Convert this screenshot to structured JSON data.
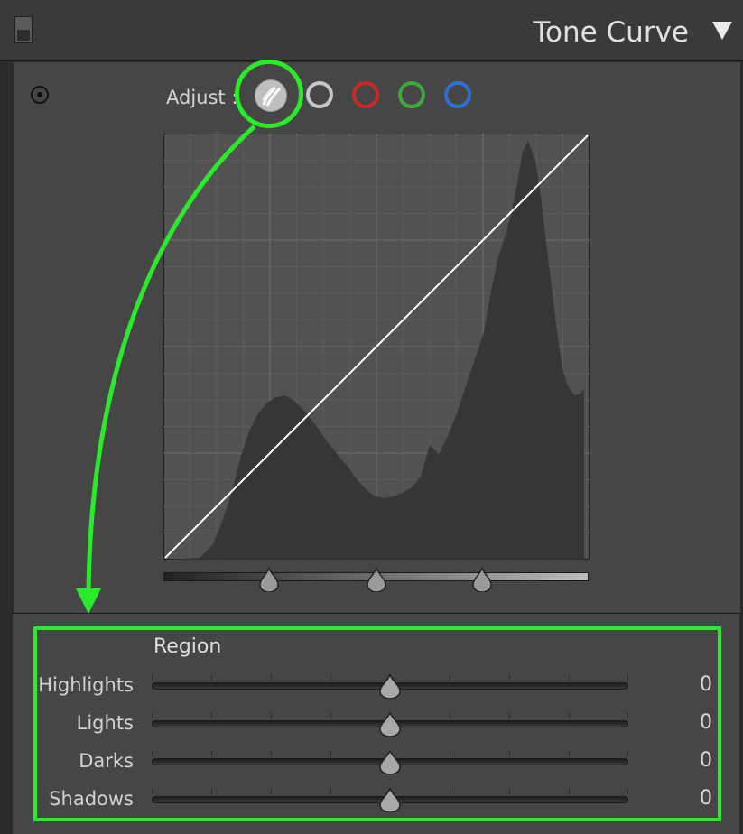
{
  "panel": {
    "title": "Tone Curve"
  },
  "adjust": {
    "label": "Adjust :",
    "channels": [
      {
        "name": "parametric",
        "color": "#bfbfbf",
        "selected": true
      },
      {
        "name": "rgb",
        "color": "#c6c6c6"
      },
      {
        "name": "red",
        "color": "#c62a2a"
      },
      {
        "name": "green",
        "color": "#3ea83e"
      },
      {
        "name": "blue",
        "color": "#2f6fd0"
      }
    ]
  },
  "curve": {
    "points": [
      [
        0,
        0
      ],
      [
        1,
        1
      ]
    ],
    "split_points": [
      0.25,
      0.5,
      0.75
    ]
  },
  "region": {
    "title": "Region",
    "sliders": [
      {
        "label": "Highlights",
        "value": "0"
      },
      {
        "label": "Lights",
        "value": "0"
      },
      {
        "label": "Darks",
        "value": "0"
      },
      {
        "label": "Shadows",
        "value": "0"
      }
    ]
  },
  "colors": {
    "annotation": "#2bea2b"
  }
}
